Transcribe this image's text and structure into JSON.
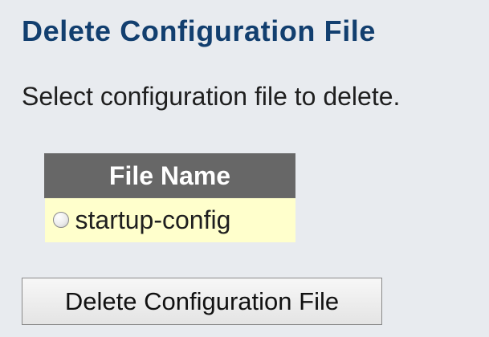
{
  "page": {
    "title": "Delete Configuration File",
    "instruction": "Select configuration file to delete."
  },
  "table": {
    "header": "File Name",
    "rows": [
      {
        "file_name": "startup-config",
        "selected": false
      }
    ]
  },
  "actions": {
    "delete_label": "Delete Configuration File"
  },
  "icons": {
    "radio": "radio-button-icon"
  },
  "colors": {
    "title": "#123f6f",
    "page_background": "#e8ebef",
    "table_header_background": "#676767",
    "table_row_background": "#ffffcc",
    "button_background": "#e9e9e9"
  }
}
